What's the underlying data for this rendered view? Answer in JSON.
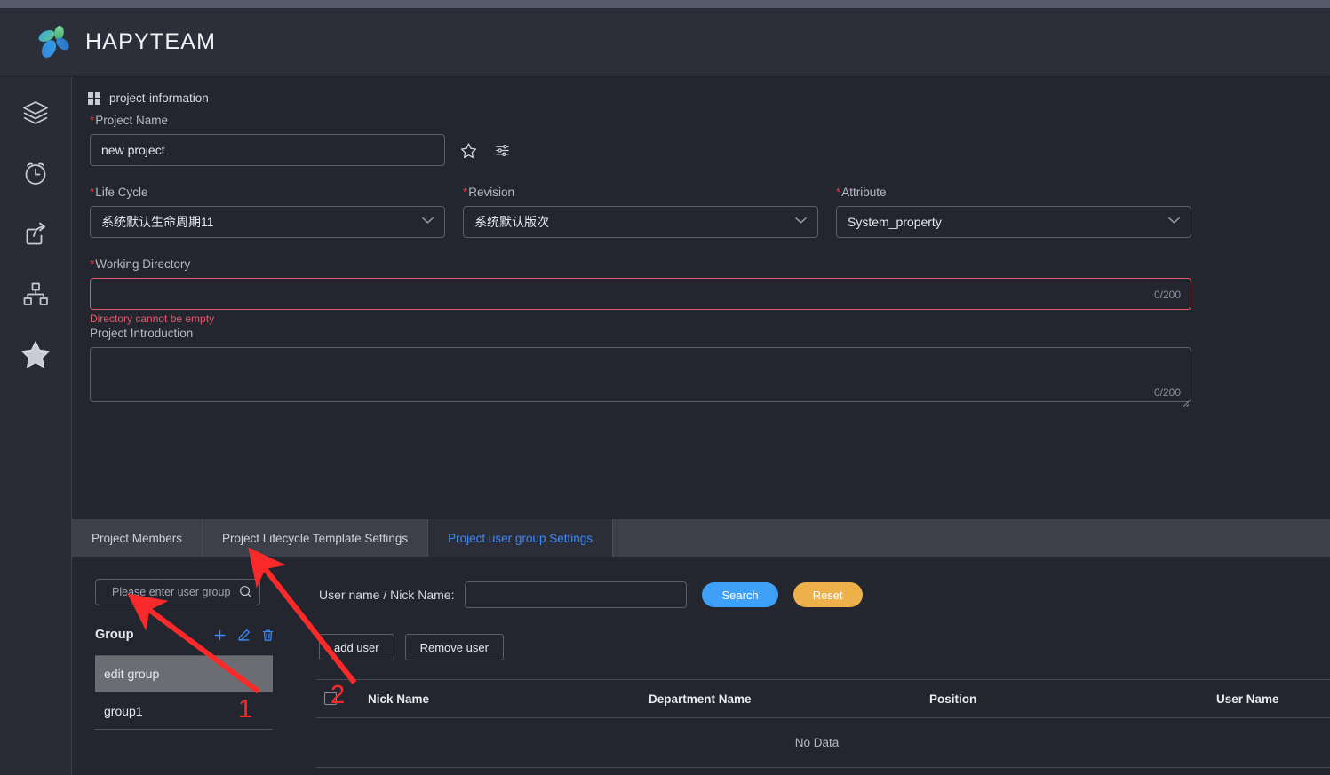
{
  "header": {
    "brand": "HAPYTEAM",
    "logo_icon": "flower-logo-icon",
    "logo_colors": [
      "#4caf6e",
      "#2d8fe0",
      "#1f7ad6",
      "#5fc98a"
    ]
  },
  "sidebar": {
    "items": [
      {
        "icon": "layers-icon",
        "name": "sidebar-item-layers"
      },
      {
        "icon": "alarm-clock-icon",
        "name": "sidebar-item-schedule"
      },
      {
        "icon": "share-export-icon",
        "name": "sidebar-item-share"
      },
      {
        "icon": "sitemap-icon",
        "name": "sidebar-item-structure"
      },
      {
        "icon": "star-icon",
        "name": "sidebar-item-favorites"
      }
    ]
  },
  "card": {
    "icon": "grid-2x2-icon",
    "title": "project-information"
  },
  "form": {
    "project_name": {
      "label": "Project Name",
      "required": true,
      "value": "new project",
      "placeholder": "",
      "star_icon": "star-outline-icon",
      "settings_icon": "sliders-icon"
    },
    "life_cycle": {
      "label": "Life Cycle",
      "required": true,
      "value": "系统默认生命周期11"
    },
    "revision": {
      "label": "Revision",
      "required": true,
      "value": "系统默认版次"
    },
    "attribute": {
      "label": "Attribute",
      "required": true,
      "value": "System_property"
    },
    "working_directory": {
      "label": "Working Directory",
      "required": true,
      "value": "",
      "placeholder": "",
      "counter": "0/200",
      "error": "Directory cannot be empty"
    },
    "project_introduction": {
      "label": "Project Introduction",
      "required": false,
      "value": "",
      "placeholder": "",
      "counter": "0/200"
    }
  },
  "tabs": [
    {
      "label": "Project Members",
      "active": false
    },
    {
      "label": "Project Lifecycle Template Settings",
      "active": false
    },
    {
      "label": "Project user group Settings",
      "active": true
    }
  ],
  "group_panel": {
    "search_placeholder": "Please enter user group",
    "search_value": "",
    "search_icon": "search-icon",
    "title": "Group",
    "actions": [
      {
        "icon": "plus-icon",
        "name": "add-group-button"
      },
      {
        "icon": "pencil-edit-icon",
        "name": "edit-group-button"
      },
      {
        "icon": "trash-delete-icon",
        "name": "delete-group-button"
      }
    ],
    "items": [
      {
        "label": "edit group",
        "selected": true
      },
      {
        "label": "group1",
        "selected": false
      }
    ]
  },
  "user_search": {
    "label": "User name / Nick Name:",
    "value": "",
    "placeholder": "",
    "search_button": "Search",
    "reset_button": "Reset",
    "search_color": "#3fa0f7",
    "reset_color": "#edb04a"
  },
  "user_actions": {
    "add_user": "add user",
    "remove_user": "Remove user"
  },
  "table": {
    "columns": [
      "Nick Name",
      "Department Name",
      "Position",
      "User Name"
    ],
    "rows": [],
    "empty_text": "No Data"
  },
  "annotations": [
    {
      "number": "1",
      "target": "edit-group-list-item",
      "color": "#fb2a2a"
    },
    {
      "number": "2",
      "target": "delete-group-button",
      "color": "#fb2a2a"
    }
  ]
}
